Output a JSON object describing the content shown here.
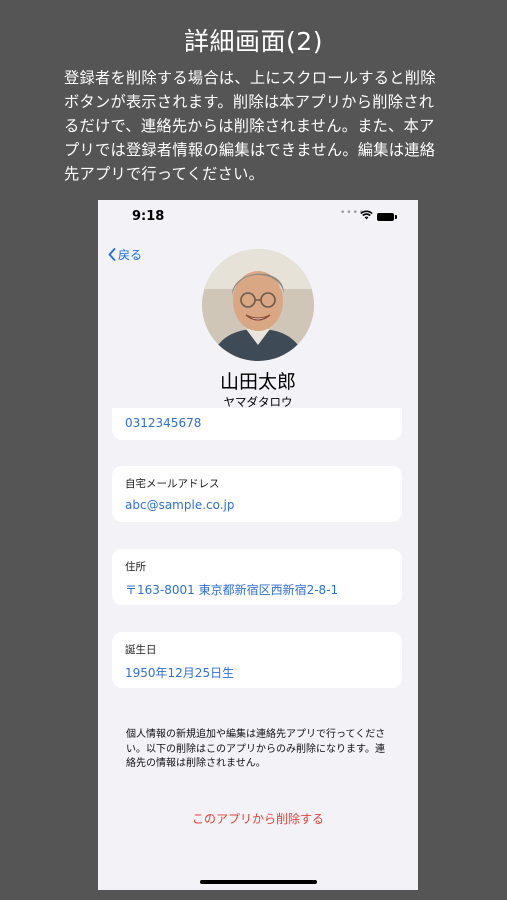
{
  "page": {
    "title": "詳細画面(2)",
    "description": "登録者を削除する場合は、上にスクロールすると削除ボタンが表示されます。削除は本アプリから削除されるだけで、連絡先からは削除されません。また、本アプリでは登録者情報の編集はできません。編集は連絡先アプリで行ってください。"
  },
  "statusbar": {
    "time": "9:18"
  },
  "nav": {
    "back_label": "戻る",
    "back_icon": "chevron-left-icon"
  },
  "contact": {
    "name": "山田太郎",
    "kana": "ヤマダタロウ",
    "partial_phone": "0312345678"
  },
  "fields": [
    {
      "label": "自宅メールアドレス",
      "value": "abc@sample.co.jp"
    },
    {
      "label": "住所",
      "value": "〒163-8001 東京都新宿区西新宿2-8-1"
    },
    {
      "label": "誕生日",
      "value": "1950年12月25日生"
    }
  ],
  "note": "個人情報の新規追加や編集は連絡先アプリで行ってください。以下の削除はこのアプリからのみ削除になります。連絡先の情報は削除されません。",
  "delete_label": "このアプリから削除する",
  "colors": {
    "link": "#2f6fd6",
    "destructive": "#e0443a",
    "backdrop": "#555555"
  }
}
